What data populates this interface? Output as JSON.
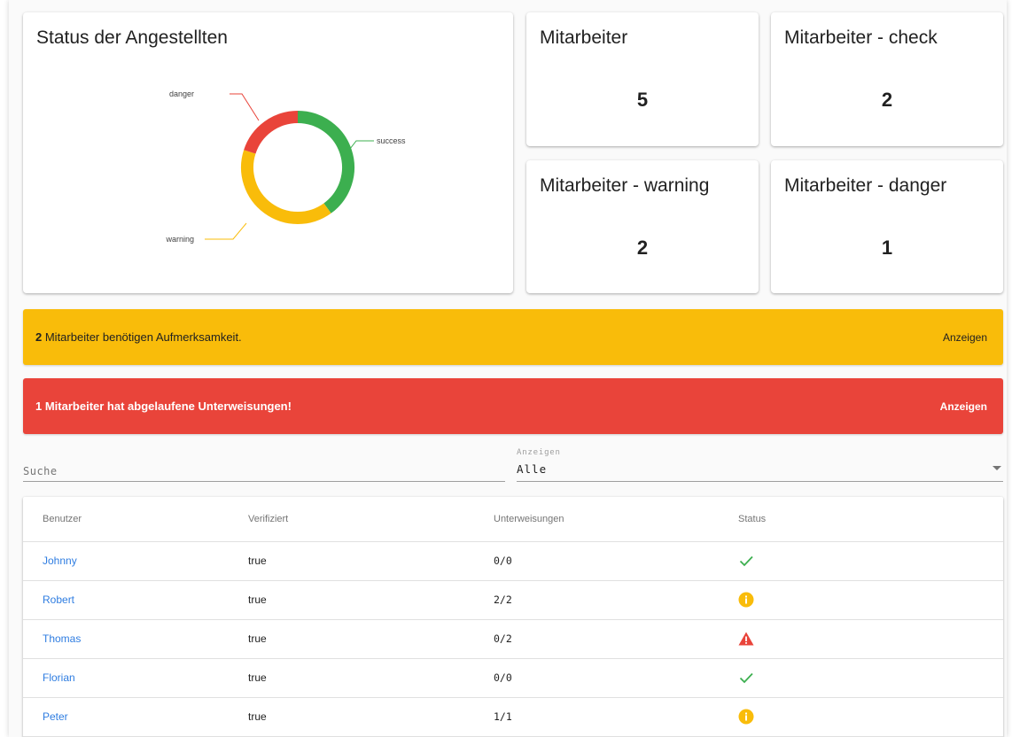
{
  "colors": {
    "success": "#3caf4f",
    "warning": "#f9bc0a",
    "danger": "#e9443a",
    "link": "#2f7de1"
  },
  "status_chart": {
    "title": "Status der Angestellten",
    "labels": {
      "danger": "danger",
      "success": "success",
      "warning": "warning"
    }
  },
  "chart_data": {
    "type": "pie",
    "title": "Status der Angestellten",
    "categories": [
      "success",
      "warning",
      "danger"
    ],
    "values": [
      2,
      2,
      1
    ],
    "colors": [
      "#3caf4f",
      "#f9bc0a",
      "#e9443a"
    ],
    "donut": true
  },
  "stats": [
    {
      "title": "Mitarbeiter",
      "value": "5"
    },
    {
      "title": "Mitarbeiter - check",
      "value": "2"
    },
    {
      "title": "Mitarbeiter - warning",
      "value": "2"
    },
    {
      "title": "Mitarbeiter - danger",
      "value": "1"
    }
  ],
  "banners": {
    "warning": {
      "count": "2",
      "text": " Mitarbeiter benötigen Aufmerksamkeit.",
      "action": "Anzeigen"
    },
    "danger": {
      "count": "1",
      "text": " Mitarbeiter hat abgelaufene Unterweisungen!",
      "action": "Anzeigen"
    }
  },
  "filters": {
    "search_placeholder": "Suche",
    "show_label": "Anzeigen",
    "show_value": "Alle"
  },
  "table": {
    "headers": [
      "Benutzer",
      "Verifiziert",
      "Unterweisungen",
      "Status"
    ],
    "rows": [
      {
        "user": "Johnny",
        "verified": "true",
        "trainings": "0/0",
        "status": "check-icon"
      },
      {
        "user": "Robert",
        "verified": "true",
        "trainings": "2/2",
        "status": "info-icon"
      },
      {
        "user": "Thomas",
        "verified": "true",
        "trainings": "0/2",
        "status": "warning-triangle-icon"
      },
      {
        "user": "Florian",
        "verified": "true",
        "trainings": "0/0",
        "status": "check-icon"
      },
      {
        "user": "Peter",
        "verified": "true",
        "trainings": "1/1",
        "status": "info-icon"
      }
    ]
  }
}
